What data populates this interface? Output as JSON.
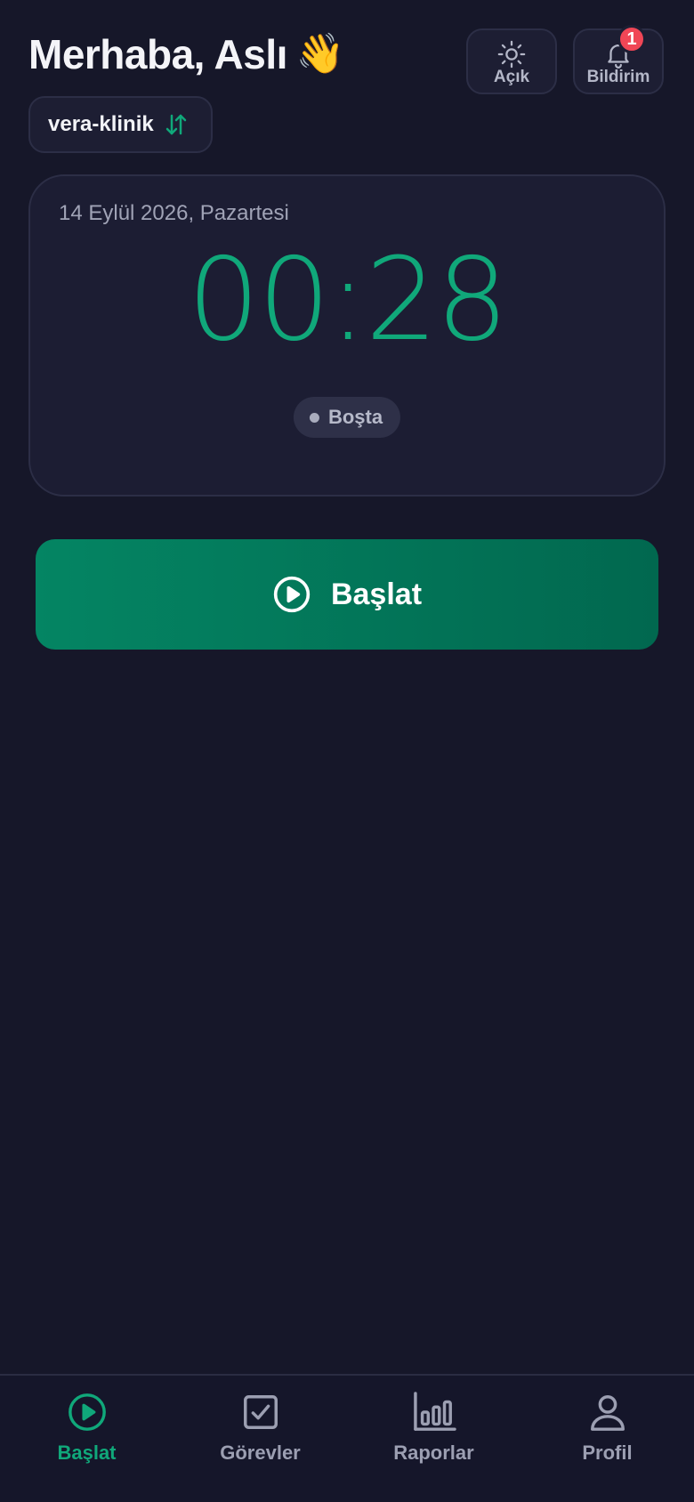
{
  "header": {
    "greeting": "Merhaba, Aslı",
    "greeting_emoji": "👋",
    "theme_button_label": "Açık",
    "notification_button_label": "Bildirim",
    "notification_count": "1"
  },
  "workspace": {
    "name": "vera-klinik",
    "icon": "swap-vertical-icon"
  },
  "timer": {
    "date": "14 Eylül 2026, Pazartesi",
    "time": "00:28",
    "status": "Boşta"
  },
  "start_button": {
    "label": "Başlat",
    "icon": "play-circle-icon"
  },
  "tabs": [
    {
      "label": "Başlat",
      "icon": "play-circle-icon",
      "active": true
    },
    {
      "label": "Görevler",
      "icon": "checkbox-icon",
      "active": false
    },
    {
      "label": "Raporlar",
      "icon": "bar-chart-icon",
      "active": false
    },
    {
      "label": "Profil",
      "icon": "user-icon",
      "active": false
    }
  ],
  "colors": {
    "background": "#161729",
    "accent": "#10a87a",
    "button_gradient_start": "#048563",
    "button_gradient_end": "#01684f",
    "badge": "#f04656",
    "muted_text": "#9c9fb2"
  }
}
